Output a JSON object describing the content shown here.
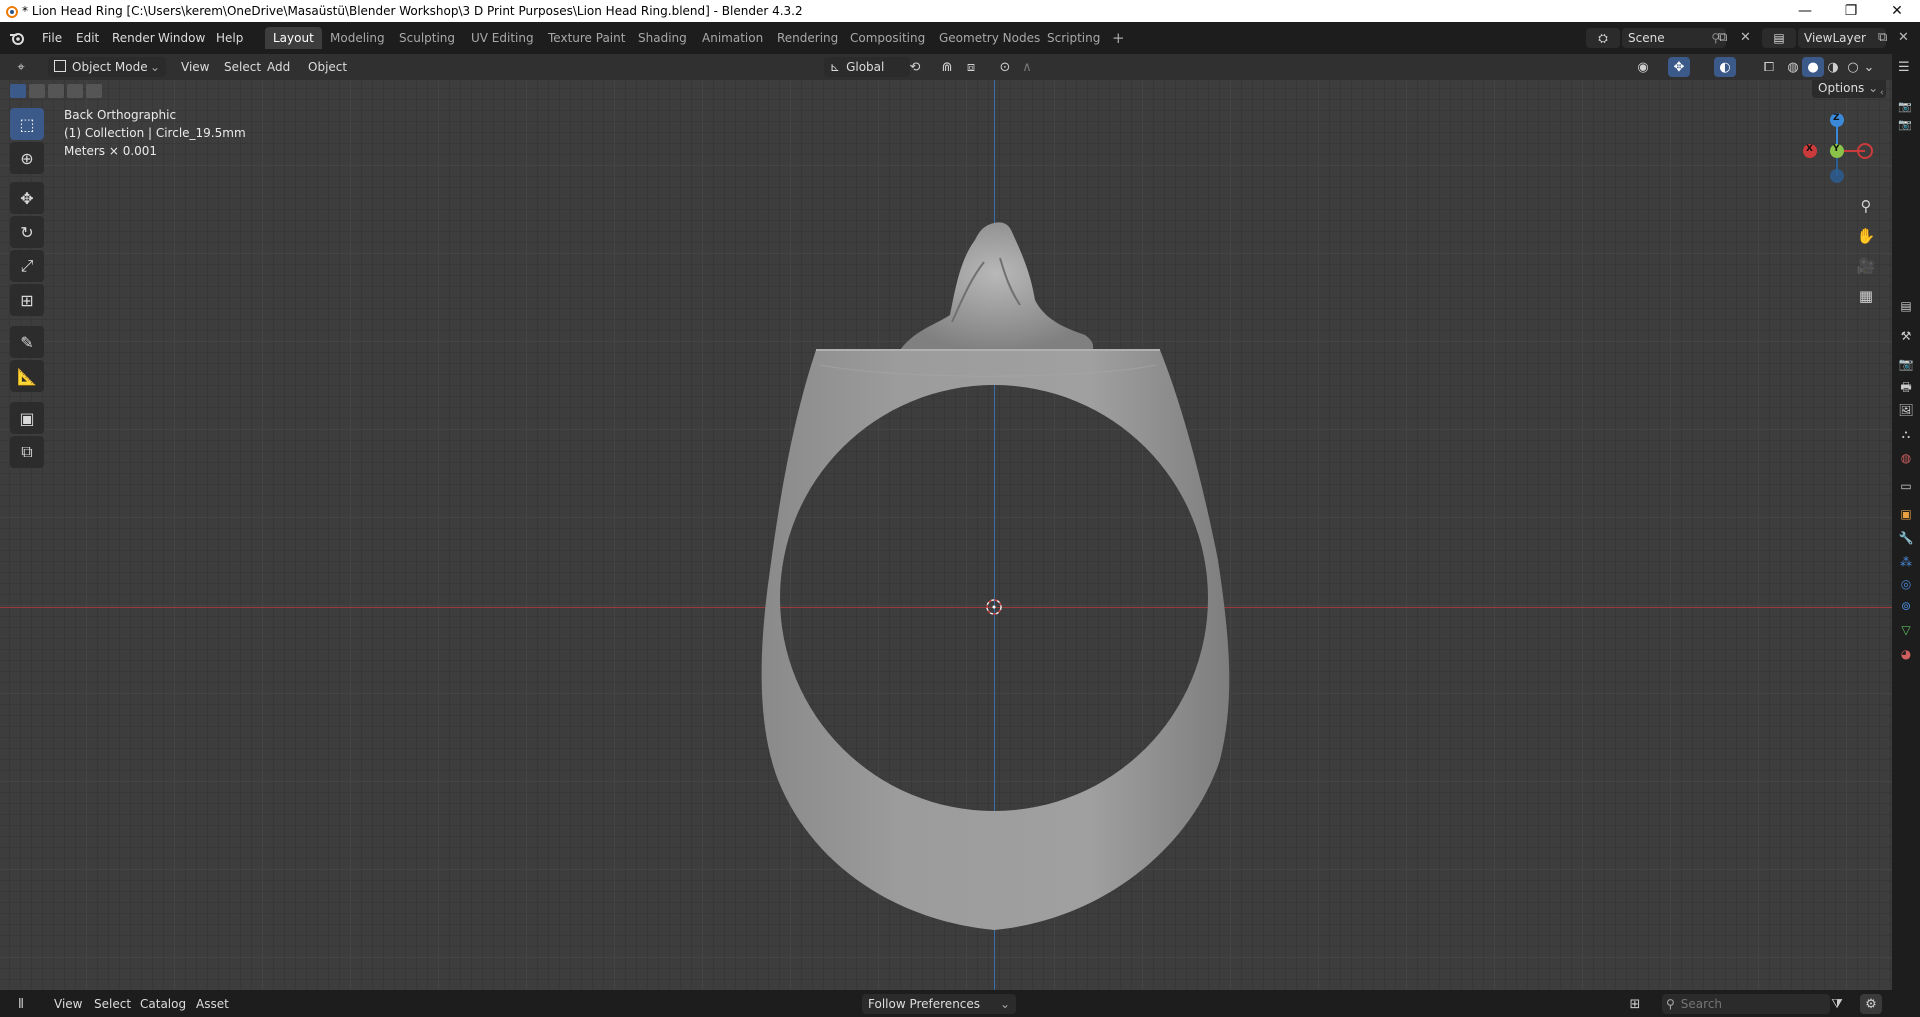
{
  "window": {
    "title": "* Lion Head Ring [C:\\Users\\kerem\\OneDrive\\Masaüstü\\Blender Workshop\\3 D Print Purposes\\Lion Head Ring.blend] - Blender 4.3.2",
    "minimize": "—",
    "maximize": "❐",
    "close": "✕"
  },
  "menu": [
    "File",
    "Edit",
    "Render",
    "Window",
    "Help"
  ],
  "workspaces": {
    "active": "Layout",
    "tabs": [
      "Layout",
      "Modeling",
      "Sculpting",
      "UV Editing",
      "Texture Paint",
      "Shading",
      "Animation",
      "Rendering",
      "Compositing",
      "Geometry Nodes",
      "Scripting"
    ],
    "add": "+"
  },
  "scene": {
    "name": "Scene",
    "view_layer": "ViewLayer"
  },
  "viewport_header": {
    "mode": "Object Mode",
    "menus": [
      "View",
      "Select",
      "Add",
      "Object"
    ],
    "orientation": "Global",
    "options": "Options"
  },
  "viewport_info": {
    "view": "Back Orthographic",
    "collection": "(1) Collection | Circle_19.5mm",
    "units": "Meters × 0.001"
  },
  "gizmo": {
    "z": "Z",
    "y": "Y",
    "x": "X"
  },
  "bottom": {
    "menus": [
      "View",
      "Select",
      "Catalog",
      "Asset"
    ],
    "library": "Follow Preferences",
    "search_placeholder": "Search"
  },
  "colors": {
    "x_axis": "#cc3b3b",
    "y_axis": "#8bc34a",
    "z_axis": "#3b8ad9",
    "active_tool": "#3b5a8a",
    "header_bg": "#1d1d1d",
    "viewport_bg": "#3d3d3d"
  }
}
